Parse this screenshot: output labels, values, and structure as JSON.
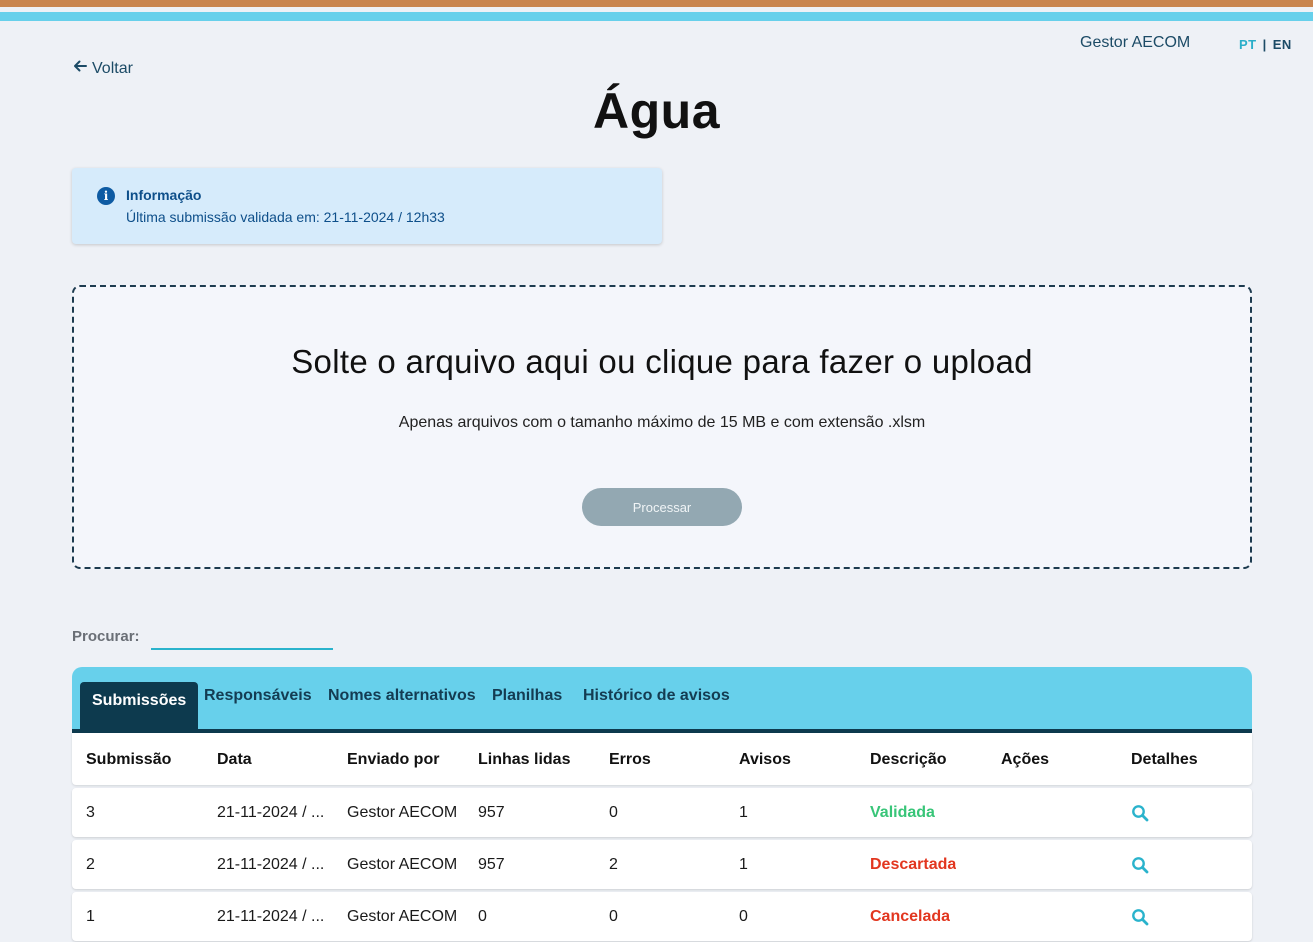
{
  "colors": {
    "stripe_orange": "#c9854e",
    "stripe_cyan": "#67d0eb",
    "accent": "#2ab3cc",
    "dark_navy": "#0d3a4e",
    "status_ok": "#38c578",
    "status_bad": "#e2361f"
  },
  "header": {
    "user_name": "Gestor AECOM",
    "lang_pt": "PT",
    "lang_sep": "|",
    "lang_en": "EN",
    "back_label": "Voltar",
    "back_icon": "arrow-left-icon"
  },
  "page": {
    "title": "Água"
  },
  "info": {
    "icon": "info-icon",
    "title": "Informação",
    "text": "Última submissão validada em: 21-11-2024 / 12h33"
  },
  "upload": {
    "title": "Solte o arquivo aqui ou clique para fazer o upload",
    "subtitle": "Apenas arquivos com o tamanho máximo de 15 MB e com extensão .xlsm",
    "process_label": "Processar"
  },
  "search": {
    "label": "Procurar:",
    "value": ""
  },
  "tabs": [
    {
      "label": "Submissões",
      "active": true
    },
    {
      "label": "Responsáveis"
    },
    {
      "label": "Nomes alternativos"
    },
    {
      "label": "Planilhas"
    },
    {
      "label": "Histórico de avisos"
    }
  ],
  "table": {
    "columns": [
      "Submissão",
      "Data",
      "Enviado por",
      "Linhas lidas",
      "Erros",
      "Avisos",
      "Descrição",
      "Ações",
      "Detalhes"
    ],
    "rows": [
      {
        "submission": "3",
        "date": "21-11-2024 / ...",
        "sent_by": "Gestor AECOM",
        "lines": "957",
        "errors": "0",
        "warnings": "1",
        "description": "Validada",
        "status": "ok",
        "details_icon": "search-icon"
      },
      {
        "submission": "2",
        "date": "21-11-2024 / ...",
        "sent_by": "Gestor AECOM",
        "lines": "957",
        "errors": "2",
        "warnings": "1",
        "description": "Descartada",
        "status": "bad",
        "details_icon": "search-icon"
      },
      {
        "submission": "1",
        "date": "21-11-2024 / ...",
        "sent_by": "Gestor AECOM",
        "lines": "0",
        "errors": "0",
        "warnings": "0",
        "description": "Cancelada",
        "status": "bad",
        "details_icon": "search-icon"
      }
    ]
  }
}
